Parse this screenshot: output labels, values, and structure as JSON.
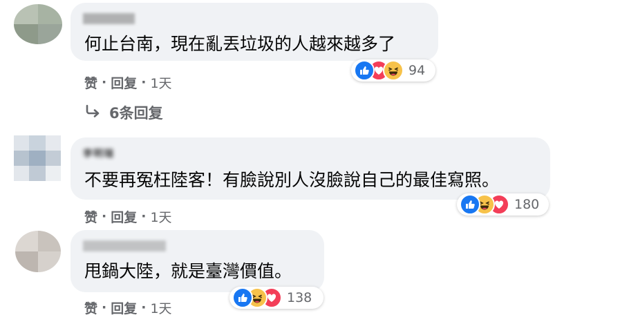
{
  "comments": [
    {
      "text": "何止台南，現在亂丟垃圾的人越來越多了",
      "reaction_count": "94",
      "reaction_types": [
        "like",
        "love",
        "haha"
      ],
      "actions": {
        "like": "赞",
        "reply": "回复",
        "time": "1天"
      },
      "replies_label": "6条回复"
    },
    {
      "author": "李明瑞",
      "text": "不要再冤枉陸客！有臉說別人沒臉說自己的最佳寫照。",
      "reaction_count": "180",
      "reaction_types": [
        "like",
        "haha",
        "love"
      ],
      "actions": {
        "like": "赞",
        "reply": "回复",
        "time": "1天"
      }
    },
    {
      "text": "甩鍋大陸，就是臺灣價值。",
      "reaction_count": "138",
      "reaction_types": [
        "like",
        "haha",
        "love"
      ],
      "actions": {
        "like": "赞",
        "reply": "回复",
        "time": "1天"
      }
    }
  ],
  "colors": {
    "bubble": "#f0f2f5",
    "secondary_text": "#65676b",
    "like": "#1877f2",
    "love": "#f33e58",
    "haha": "#f7c24a"
  },
  "icons": {
    "like": "thumbs-up-icon",
    "love": "heart-icon",
    "haha": "laughing-face-icon",
    "reply_arrow": "reply-arrow-icon"
  }
}
